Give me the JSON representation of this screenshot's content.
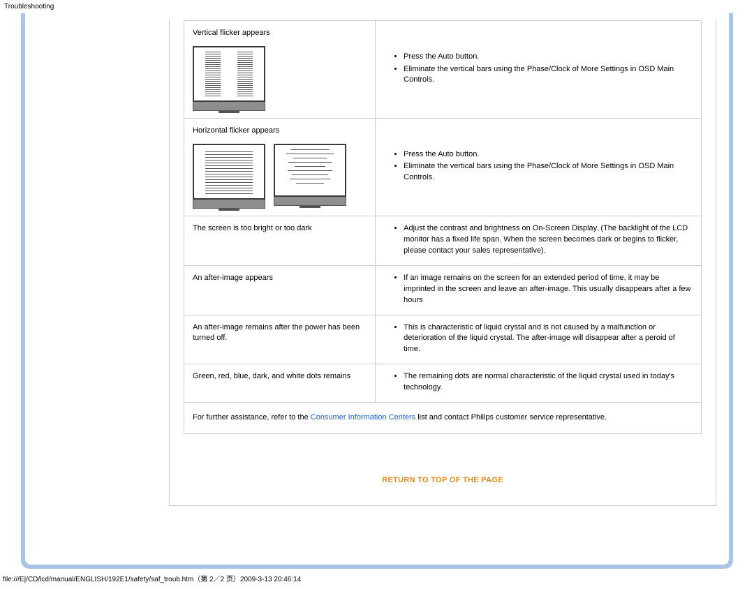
{
  "header": {
    "title": "Troubleshooting"
  },
  "rows": [
    {
      "problem": "Vertical flicker appears",
      "solutions": [
        "Press the Auto button.",
        "Eliminate the vertical bars using the Phase/Clock of More Settings in OSD Main Controls."
      ]
    },
    {
      "problem": "Horizontal flicker appears",
      "solutions": [
        "Press the Auto button.",
        "Eliminate the vertical bars using the Phase/Clock of More Settings in OSD Main Controls."
      ]
    },
    {
      "problem": "The screen is too bright or too dark",
      "solutions": [
        "Adjust the contrast and brightness on On-Screen Display. (The backlight of the LCD monitor has a fixed life span. When the screen becomes dark or begins to flicker, please contact your sales representative)."
      ]
    },
    {
      "problem": "An after-image appears",
      "solutions": [
        "If an image remains on the screen for an extended period of time, it may be imprinted in the screen and leave an after-image. This usually disappears after a few hours"
      ]
    },
    {
      "problem": "An after-image remains after the power has been turned off.",
      "solutions": [
        "This is characteristic of liquid crystal and is not caused by a malfunction or deterioration of the liquid crystal. The after-image will disappear after a peroid of time."
      ]
    },
    {
      "problem": "Green, red, blue, dark, and white dots remains",
      "solutions": [
        "The remaining dots are normal characteristic of the liquid crystal used in today's technology."
      ]
    }
  ],
  "footer_note": {
    "before": "For further assistance, refer to the ",
    "link": "Consumer Information Centers",
    "after": " list and contact Philips customer service representative."
  },
  "return_link": "RETURN TO TOP OF THE PAGE",
  "file_path": "file:///E|/CD/lcd/manual/ENGLISH/192E1/safety/saf_troub.htm（第 2／2 页）2009-3-13 20:46:14"
}
